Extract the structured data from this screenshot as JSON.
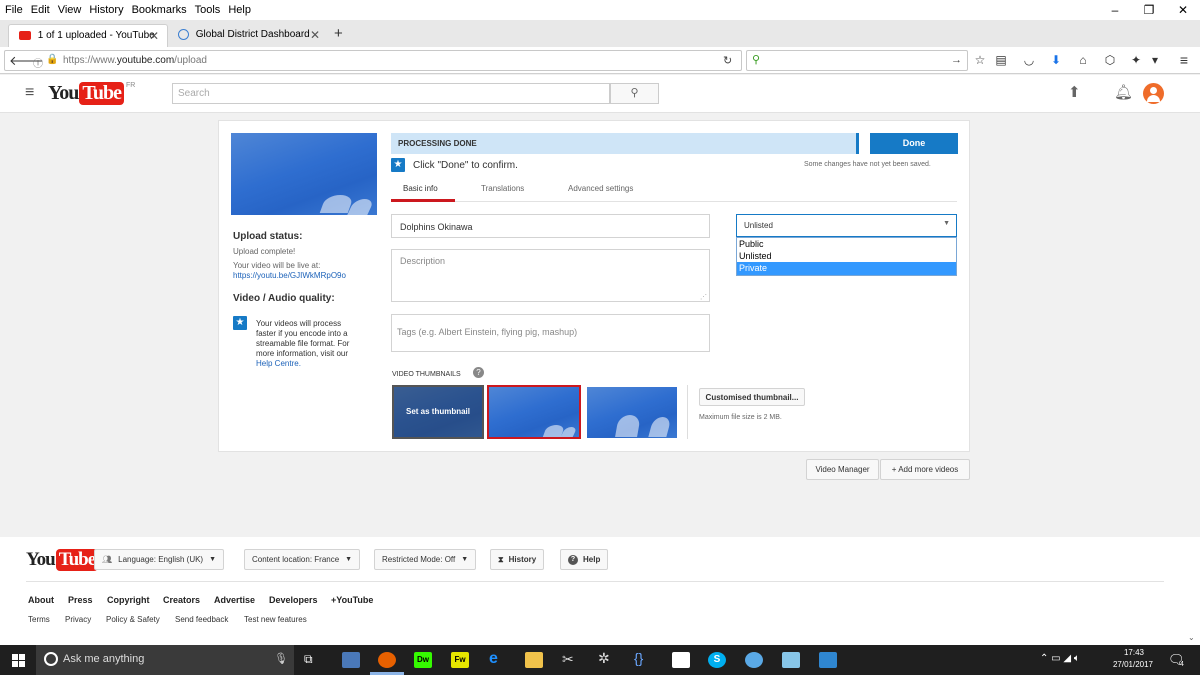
{
  "menubar": {
    "items": [
      "File",
      "Edit",
      "View",
      "History",
      "Bookmarks",
      "Tools",
      "Help"
    ]
  },
  "window_controls": {
    "minimize": "–",
    "restore": "❐",
    "close": "✕"
  },
  "tabs": [
    {
      "label": "1 of 1 uploaded - YouTube",
      "active": true
    },
    {
      "label": "Global District Dashboard",
      "active": false
    }
  ],
  "new_tab_label": "+",
  "navbar": {
    "url_prefix": "https://www.",
    "url_domain": "youtube.com",
    "url_path": "/upload"
  },
  "yt": {
    "logo_you": "You",
    "logo_tube": "Tube",
    "logo_region": "FR",
    "search_placeholder": "Search"
  },
  "upload": {
    "processing_label": "PROCESSING DONE",
    "done_button": "Done",
    "confirm_text": "Click \"Done\" to confirm.",
    "unsaved_note": "Some changes have not yet been saved.",
    "tabs": [
      "Basic info",
      "Translations",
      "Advanced settings"
    ],
    "title_value": "Dolphins Okinawa",
    "description_placeholder": "Description",
    "tags_placeholder": "Tags (e.g. Albert Einstein, flying pig, mashup)",
    "privacy": {
      "selected": "Unlisted",
      "options": [
        "Public",
        "Unlisted",
        "Private"
      ],
      "highlighted": "Private"
    },
    "thumbnails_label": "VIDEO THUMBNAILS",
    "set_as_thumbnail": "Set as thumbnail",
    "custom_thumbnail_button": "Customised thumbnail...",
    "max_file_size": "Maximum file size is 2 MB."
  },
  "sidebar": {
    "upload_status_heading": "Upload status:",
    "upload_complete": "Upload complete!",
    "live_at": "Your video will be live at:",
    "video_url": "https://youtu.be/GJIWkMRpO9o",
    "quality_heading": "Video / Audio quality:",
    "quality_text_1": "Your videos will process",
    "quality_text_2": "faster if you encode into a",
    "quality_text_3": "streamable file format. For",
    "quality_text_4": "more information, visit our",
    "help_centre": "Help Centre."
  },
  "below_card": {
    "video_manager": "Video Manager",
    "add_more_videos": "+ Add more videos"
  },
  "footer": {
    "language": "Language: English (UK)",
    "content_location": "Content location: France",
    "restricted_mode": "Restricted Mode: Off",
    "history": "History",
    "help": "Help",
    "links": [
      "About",
      "Press",
      "Copyright",
      "Creators",
      "Advertise",
      "Developers",
      "+YouTube"
    ],
    "links2": [
      "Terms",
      "Privacy",
      "Policy & Safety",
      "Send feedback",
      "Test new features"
    ]
  },
  "taskbar": {
    "search_placeholder": "Ask me anything",
    "time": "17:43",
    "date": "27/01/2017",
    "notification_count": "4"
  },
  "colors": {
    "accent_blue": "#167ac6",
    "yt_red": "#e62117",
    "processing_bar": "#cfe5f7",
    "selected_option": "#3399ff"
  }
}
